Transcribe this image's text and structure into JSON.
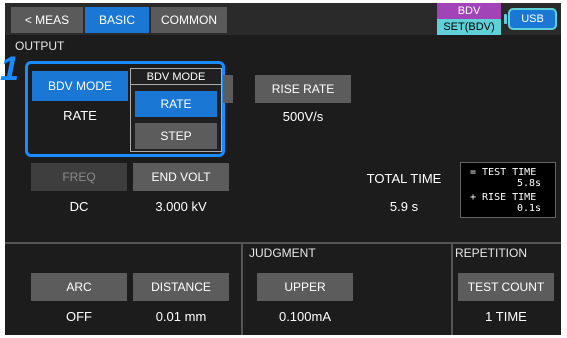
{
  "tabs": {
    "meas": "< MEAS",
    "basic": "BASIC",
    "common": "COMMON"
  },
  "status": {
    "bdv_top": "BDV",
    "bdv_bottom": "SET(BDV)",
    "usb": "USB"
  },
  "output": {
    "section_label": "OUTPUT",
    "callout_number": "1",
    "bdv_mode": {
      "label": "BDV MODE",
      "value": "RATE"
    },
    "popup": {
      "title": "BDV MODE",
      "options": [
        "RATE",
        "STEP"
      ],
      "selected": "RATE"
    },
    "rise_rate": {
      "label": "RISE RATE",
      "value": "500V/s"
    },
    "freq": {
      "label": "FREQ",
      "value": "DC"
    },
    "end_volt": {
      "label": "END VOLT",
      "value": "3.000 kV"
    },
    "total_time": {
      "label": "TOTAL TIME",
      "value": "5.9 s"
    },
    "time_breakdown": {
      "test_label": "= TEST TIME",
      "test_value": "5.8s",
      "rise_label": "+ RISE TIME",
      "rise_value": "0.1s"
    }
  },
  "bottom": {
    "arc": {
      "label": "ARC",
      "value": "OFF"
    },
    "distance": {
      "label": "DISTANCE",
      "value": "0.01 mm"
    },
    "judgment": {
      "section_label": "JUDGMENT",
      "label": "UPPER",
      "value": "0.100mA"
    },
    "repetition": {
      "section_label": "REPETITION",
      "label": "TEST COUNT",
      "value": "1 TIME"
    }
  },
  "colors": {
    "accent": "#1a78d4",
    "highlight_border": "#1a8cff",
    "bdv_status": "#a243b8",
    "set_status": "#5fd0d8"
  }
}
